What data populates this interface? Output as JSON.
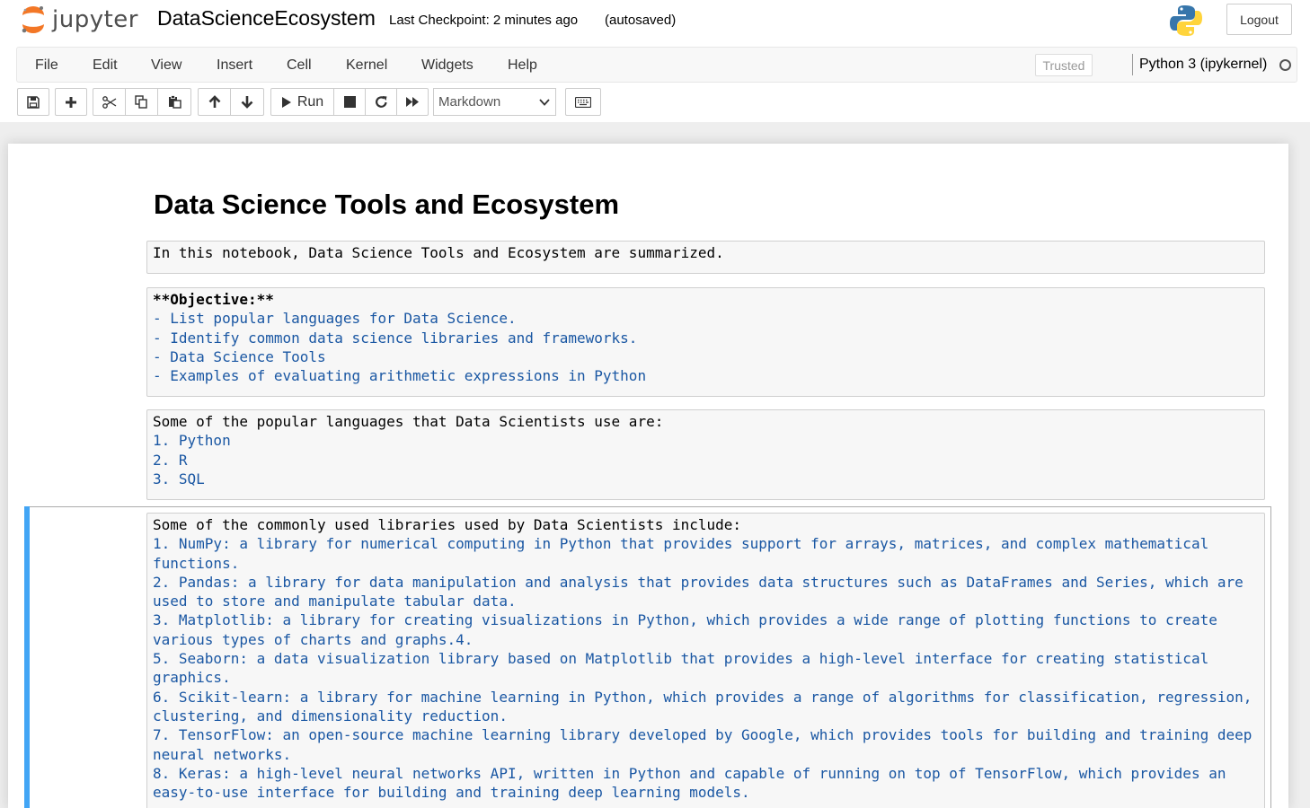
{
  "header": {
    "logo_text": "jupyter",
    "notebook_name": "DataScienceEcosystem",
    "checkpoint": "Last Checkpoint: 2 minutes ago",
    "autosave_status": "(autosaved)",
    "logout_label": "Logout"
  },
  "menubar": {
    "items": [
      "File",
      "Edit",
      "View",
      "Insert",
      "Cell",
      "Kernel",
      "Widgets",
      "Help"
    ],
    "trusted_label": "Trusted",
    "kernel_name": "Python 3 (ipykernel)"
  },
  "toolbar": {
    "run_label": "Run",
    "cell_type": "Markdown",
    "icons": [
      "save-icon",
      "plus-icon",
      "cut-icon",
      "copy-icon",
      "paste-icon",
      "arrow-up-icon",
      "arrow-down-icon",
      "run-icon",
      "stop-icon",
      "restart-icon",
      "fast-forward-icon",
      "keyboard-icon"
    ]
  },
  "notebook": {
    "heading": "Data Science Tools and Ecosystem",
    "cells": [
      {
        "lines": [
          "In this notebook, Data Science Tools and Ecosystem are summarized."
        ]
      },
      {
        "lines": [
          "**Objective:**",
          "- List popular languages for Data Science.",
          "- Identify common data science libraries and frameworks.",
          "- Data Science Tools",
          "- Examples of evaluating arithmetic expressions in Python"
        ]
      },
      {
        "lines": [
          "Some of the popular languages that Data Scientists use are:",
          "1. Python",
          "2. R",
          "3. SQL"
        ]
      },
      {
        "lines": [
          "Some of the commonly used libraries used by Data Scientists include:",
          "1. NumPy: a library for numerical computing in Python that provides support for arrays, matrices, and complex mathematical",
          "functions.",
          "2. Pandas: a library for data manipulation and analysis that provides data structures such as DataFrames and Series, which are",
          "used to store and manipulate tabular data.",
          "3. Matplotlib: a library for creating visualizations in Python, which provides a wide range of plotting functions to create",
          "various types of charts and graphs.4.",
          "5. Seaborn: a data visualization library based on Matplotlib that provides a high-level interface for creating statistical",
          "graphics.",
          "6. Scikit-learn: a library for machine learning in Python, which provides a range of algorithms for classification, regression,",
          "clustering, and dimensionality reduction.",
          "7. TensorFlow: an open-source machine learning library developed by Google, which provides tools for building and training deep",
          "neural networks.",
          "8. Keras: a high-level neural networks API, written in Python and capable of running on top of TensorFlow, which provides an",
          "easy-to-use interface for building and training deep learning models."
        ]
      }
    ]
  },
  "colors": {
    "markdown_list": "#1a57a3",
    "selection_bar": "#42a5f5",
    "jupyter_orange": "#f37726"
  }
}
